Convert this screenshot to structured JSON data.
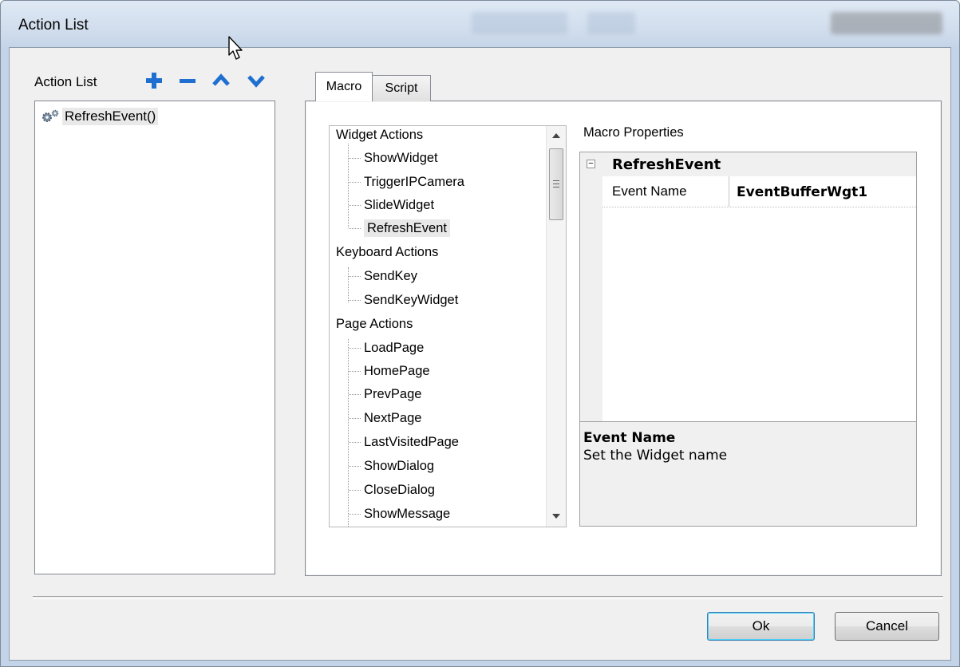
{
  "window": {
    "title": "Action List"
  },
  "left_panel": {
    "label": "Action List",
    "toolbar": [
      "add-icon",
      "remove-icon",
      "move-up-icon",
      "move-down-icon"
    ],
    "items": [
      {
        "label": "RefreshEvent()",
        "icon": "gear-icon"
      }
    ]
  },
  "tabs": [
    {
      "label": "Macro",
      "active": true
    },
    {
      "label": "Script",
      "active": false
    }
  ],
  "tree": {
    "categories": [
      {
        "label": "Widget Actions",
        "items": [
          "ShowWidget",
          "TriggerIPCamera",
          "SlideWidget",
          "RefreshEvent"
        ]
      },
      {
        "label": "Keyboard Actions",
        "items": [
          "SendKey",
          "SendKeyWidget"
        ]
      },
      {
        "label": "Page Actions",
        "items": [
          "LoadPage",
          "HomePage",
          "PrevPage",
          "NextPage",
          "LastVisitedPage",
          "ShowDialog",
          "CloseDialog",
          "ShowMessage"
        ]
      }
    ],
    "selected": "RefreshEvent"
  },
  "properties": {
    "label": "Macro Properties",
    "category": "RefreshEvent",
    "rows": [
      {
        "name": "Event Name",
        "value": "EventBufferWgt1"
      }
    ],
    "help_title": "Event Name",
    "help_desc": "Set the Widget name"
  },
  "buttons": {
    "ok": "Ok",
    "cancel": "Cancel"
  },
  "colors": {
    "accent_icon": "#1f6fd1",
    "frame": "#c4d4e8"
  }
}
